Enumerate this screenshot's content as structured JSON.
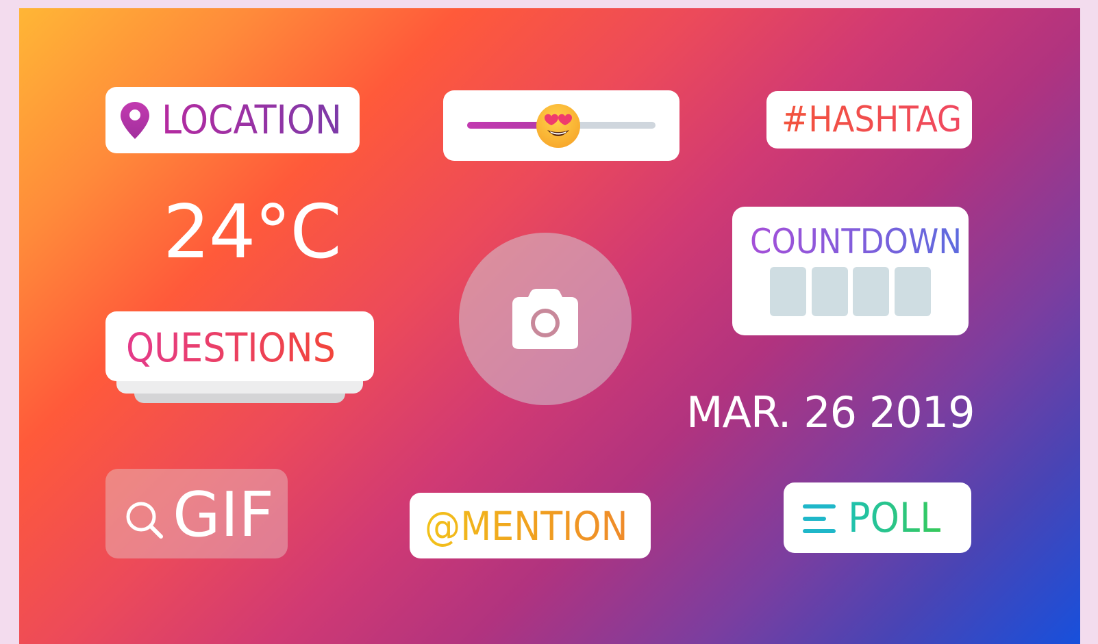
{
  "stickers": {
    "location": {
      "label": "LOCATION",
      "icon": "location-pin-icon"
    },
    "slider": {
      "emoji": "heart-eyes-emoji",
      "value": 0.48
    },
    "hashtag": {
      "label": "#HASHTAG"
    },
    "temperature": {
      "label": "24°C"
    },
    "countdown": {
      "label": "COUNTDOWN",
      "slots": 4
    },
    "questions": {
      "label": "QUESTIONS"
    },
    "camera": {
      "icon": "camera-icon"
    },
    "date": {
      "label": "MAR. 26 2019"
    },
    "gif": {
      "label": "GIF",
      "icon": "search-icon"
    },
    "mention": {
      "label": "@MENTION"
    },
    "poll": {
      "label": "POLL",
      "icon": "poll-lines-icon"
    }
  },
  "colors": {
    "location": "#b52aa0",
    "hashtag": "#f2533c",
    "countdown": "#8a4fd8",
    "questions": "#ee3a6a",
    "mention": "#f3a21e",
    "poll": "#1fc1b0",
    "slider_track": "#cfd6dd",
    "slider_fill": "#c23ab0"
  }
}
